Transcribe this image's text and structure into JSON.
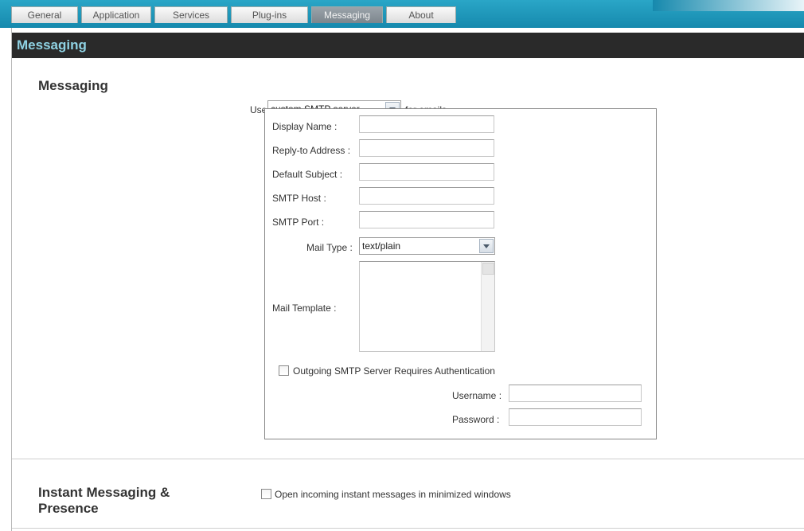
{
  "tabs": [
    {
      "label": "General"
    },
    {
      "label": "Application"
    },
    {
      "label": "Services"
    },
    {
      "label": "Plug-ins"
    },
    {
      "label": "Messaging",
      "active": true
    },
    {
      "label": "About"
    }
  ],
  "header": {
    "title": "Messaging"
  },
  "messaging": {
    "section_title": "Messaging",
    "use_prefix": "Use",
    "server_select_value": "custom SMTP server",
    "use_suffix": "for emails",
    "fields": {
      "display_name_label": "Display Name :",
      "display_name_value": "",
      "reply_to_label": "Reply-to Address :",
      "reply_to_value": "",
      "default_subject_label": "Default Subject :",
      "default_subject_value": "",
      "smtp_host_label": "SMTP Host :",
      "smtp_host_value": "",
      "smtp_port_label": "SMTP Port :",
      "smtp_port_value": "",
      "mail_type_label": "Mail Type :",
      "mail_type_value": "text/plain",
      "mail_template_label": "Mail Template :",
      "mail_template_value": ""
    },
    "auth_checkbox_label": "Outgoing SMTP Server Requires Authentication",
    "auth_checked": false,
    "username_label": "Username :",
    "username_value": "",
    "password_label": "Password :",
    "password_value": ""
  },
  "im": {
    "section_title_line1": "Instant Messaging &",
    "section_title_line2": "Presence",
    "minimized_checkbox_label": "Open incoming instant messages in minimized windows",
    "minimized_checked": false
  },
  "icons": {
    "dropdown": "chevron-down-icon",
    "scrollbar": "scrollbar-arrow-icon"
  },
  "colors": {
    "tabbar": "#1f9ec0",
    "header_bg": "#2a2a2a",
    "header_text": "#8fd2e3",
    "active_tab": "#8a939a"
  }
}
